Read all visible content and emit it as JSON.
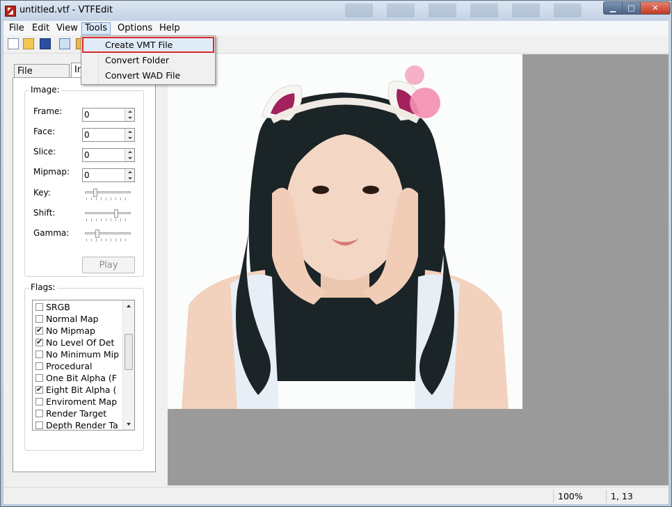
{
  "window": {
    "title": "untitled.vtf - VTFEdit"
  },
  "menubar": {
    "items": [
      {
        "id": "file",
        "label": "File"
      },
      {
        "id": "edit",
        "label": "Edit"
      },
      {
        "id": "view",
        "label": "View"
      },
      {
        "id": "tools",
        "label": "Tools"
      },
      {
        "id": "options",
        "label": "Options"
      },
      {
        "id": "help",
        "label": "Help"
      }
    ]
  },
  "tools_menu": {
    "items": [
      "Create VMT File",
      "Convert Folder",
      "Convert WAD File"
    ],
    "highlighted": "Create VMT File"
  },
  "toolbar": {
    "icons": [
      "new-icon",
      "open-icon",
      "save-icon",
      "copy-icon",
      "paste-icon"
    ]
  },
  "left_panel": {
    "tabs": [
      "File System",
      "In"
    ],
    "image_group": {
      "title": "Image:",
      "frame_label": "Frame:",
      "frame_value": "0",
      "face_label": "Face:",
      "face_value": "0",
      "slice_label": "Slice:",
      "slice_value": "0",
      "mipmap_label": "Mipmap:",
      "mipmap_value": "0",
      "key_label": "Key:",
      "key_level": 0.2,
      "shift_label": "Shift:",
      "shift_level": 0.7,
      "gamma_label": "Gamma:",
      "gamma_level": 0.25,
      "play_label": "Play"
    },
    "flags_group": {
      "title": "Flags:",
      "items": [
        {
          "label": "SRGB",
          "checked": false
        },
        {
          "label": "Normal Map",
          "checked": false
        },
        {
          "label": "No Mipmap",
          "checked": true
        },
        {
          "label": "No Level Of Det",
          "checked": true
        },
        {
          "label": "No Minimum Mip",
          "checked": false
        },
        {
          "label": "Procedural",
          "checked": false
        },
        {
          "label": "One Bit Alpha (F",
          "checked": false
        },
        {
          "label": "Eight Bit Alpha (",
          "checked": true
        },
        {
          "label": "Enviroment Map",
          "checked": false
        },
        {
          "label": "Render Target",
          "checked": false
        },
        {
          "label": "Depth Render Ta",
          "checked": false
        }
      ]
    }
  },
  "statusbar": {
    "zoom": "100%",
    "coords": "1, 13"
  },
  "colors": {
    "highlight_outline": "#d62b2b",
    "viewport_bg": "#9a9a9a"
  }
}
